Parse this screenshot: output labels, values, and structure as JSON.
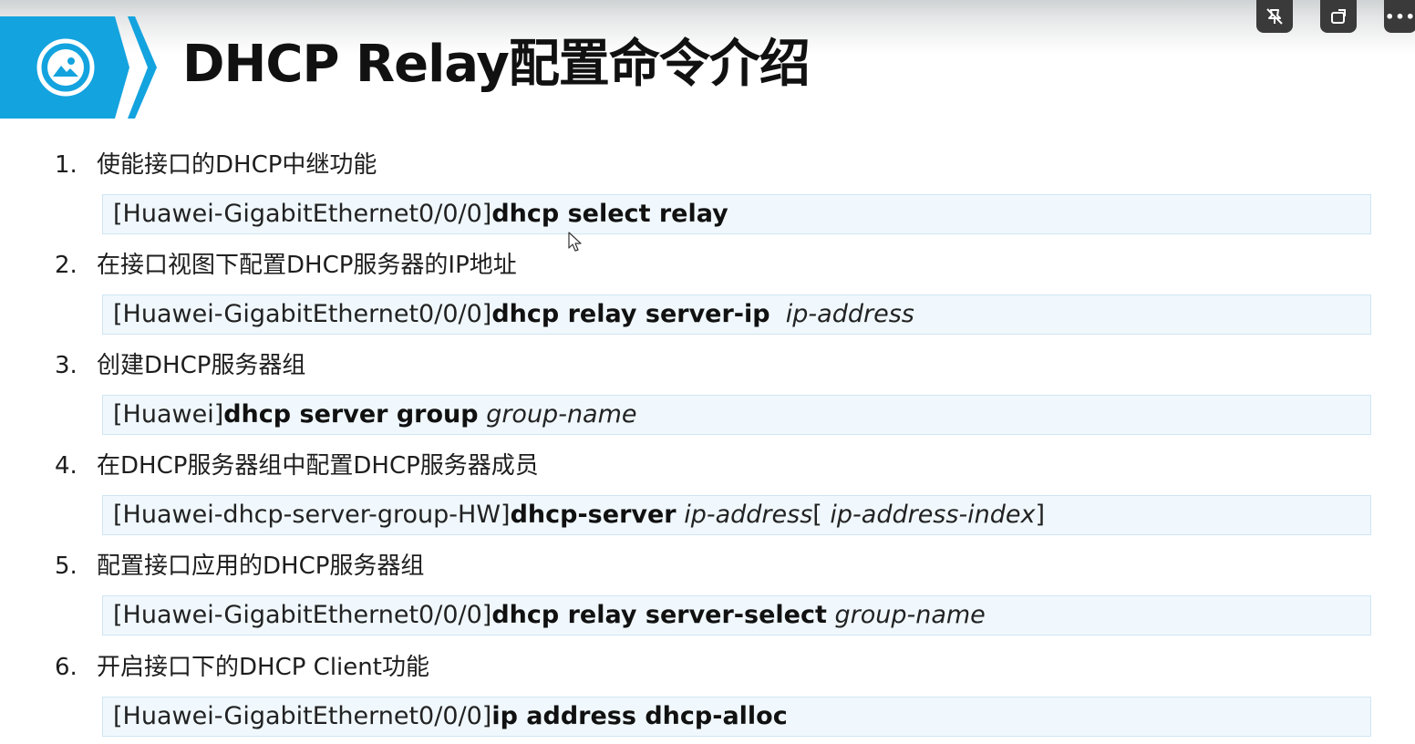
{
  "slide": {
    "title": "DHCP Relay配置命令介绍"
  },
  "controls": [
    {
      "icon": "unpin-icon"
    },
    {
      "icon": "popout-icon"
    },
    {
      "icon": "more-icon",
      "label": "•••"
    }
  ],
  "steps": [
    {
      "number": "1.",
      "title": "使能接口的DHCP中继功能",
      "command": {
        "prefix": "[Huawei-GigabitEthernet0/0/0]",
        "keyword": "dhcp select relay",
        "param": "",
        "tail": ""
      }
    },
    {
      "number": "2.",
      "title": "在接口视图下配置DHCP服务器的IP地址",
      "command": {
        "prefix": "[Huawei-GigabitEthernet0/0/0]",
        "keyword": "dhcp relay server-ip",
        "param": "ip-address",
        "tail": ""
      }
    },
    {
      "number": "3.",
      "title": "创建DHCP服务器组",
      "command": {
        "prefix": "[Huawei]",
        "keyword": "dhcp server group",
        "param": "group-name",
        "tail": ""
      }
    },
    {
      "number": "4.",
      "title": "在DHCP服务器组中配置DHCP服务器成员",
      "command": {
        "prefix": "[Huawei-dhcp-server-group-HW]",
        "keyword": "dhcp-server",
        "param": "ip-address",
        "tail": "[ ",
        "param2": "ip-address-index",
        "tail2": "]"
      }
    },
    {
      "number": "5.",
      "title": "配置接口应用的DHCP服务器组",
      "command": {
        "prefix": "[Huawei-GigabitEthernet0/0/0]",
        "keyword": "dhcp relay server-select",
        "param": "group-name",
        "tail": ""
      }
    },
    {
      "number": "6.",
      "title": "开启接口下的DHCP Client功能",
      "command": {
        "prefix": "[Huawei-GigabitEthernet0/0/0]",
        "keyword": "ip address dhcp-alloc",
        "param": "",
        "tail": ""
      }
    }
  ]
}
